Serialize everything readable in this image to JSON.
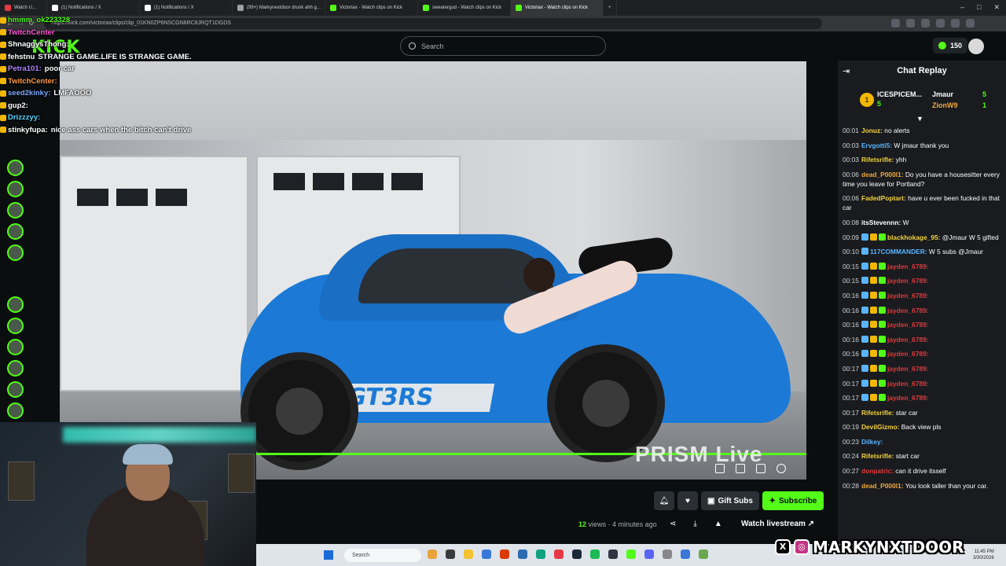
{
  "browser": {
    "tabs": [
      {
        "label": "Watch U...",
        "color": "#e63946"
      },
      {
        "label": "(1) Notifications / X",
        "color": "#ffffff"
      },
      {
        "label": "(1) Notifications / X",
        "color": "#ffffff"
      },
      {
        "label": "(99+) Markynextdoor drunk ahh g...",
        "color": "#9aa0a6"
      },
      {
        "label": "Victoriax - Watch clips on Kick",
        "color": "#53fc18"
      },
      {
        "label": "sweatergud - Watch clips on Kick",
        "color": "#53fc18"
      },
      {
        "label": "Victoriax - Watch clips on Kick",
        "color": "#53fc18"
      }
    ],
    "url": "https://kick.com/victoriax/clips/clip_01KN0ZP6NSCGN6RC8JRQT1DGDS"
  },
  "header": {
    "logo": "KICK",
    "search_placeholder": "Search",
    "points": "150"
  },
  "overlay_chat": [
    {
      "user": "hmmm_ok223328",
      "msg": "",
      "color": "#53fc18"
    },
    {
      "user": "TwitchCenter",
      "msg": "",
      "color": "#ff5ad7"
    },
    {
      "user": "ShnaggysThong:",
      "msg": "",
      "color": "#ffffff"
    },
    {
      "user": "fehstnu",
      "msg": "STRANGE GAME.LIFE IS STRANGE GAME.",
      "color": "#ffffff"
    },
    {
      "user": "Petra101:",
      "msg": "poor car",
      "color": "#b084ff"
    },
    {
      "user": "TwitchCenter:",
      "msg": "",
      "color": "#ff9a4a"
    },
    {
      "user": "seed2kinky:",
      "msg": "LMFAOOO",
      "color": "#7aa7ff"
    },
    {
      "user": "gup2:",
      "msg": "",
      "color": "#ffffff"
    },
    {
      "user": "Drizzzyy:",
      "msg": "",
      "color": "#5ad1ff"
    },
    {
      "user": "stinkyfupa:",
      "msg": "nice ass cars when the bitch can't drive",
      "color": "#ffffff"
    }
  ],
  "video": {
    "plate": "GT3RS",
    "watermark": "PRISM Live"
  },
  "actions": {
    "gift_label": "Gift Subs",
    "subscribe_label": "Subscribe",
    "views": "12",
    "views_suffix": "views",
    "ago": "4 minutes ago",
    "watch_livestream": "Watch livestream"
  },
  "chat_replay": {
    "title": "Chat Replay",
    "leaderboard": {
      "first": {
        "name": "ICESPICEM...",
        "count": "5"
      },
      "second": {
        "name": "Jmaur",
        "count": "5"
      },
      "third": {
        "name": "ZionW9",
        "count": "1"
      }
    },
    "messages": [
      {
        "time": "00:01",
        "user": "Jonuz:",
        "color": "#f2d23c",
        "text": "no alerts"
      },
      {
        "time": "00:03",
        "user": "Ervgotti5:",
        "color": "#5ab4ff",
        "text": "W jmaur thank you"
      },
      {
        "time": "00:03",
        "user": "Rifetsrifle:",
        "color": "#f2d23c",
        "text": "yhh"
      },
      {
        "time": "00:06",
        "user": "dead_P000l1:",
        "color": "#f2a93c",
        "text": "Do you have a housesitter every time you leave for Portland?"
      },
      {
        "time": "00:06",
        "user": "FadedPoptart:",
        "color": "#f2d23c",
        "text": "have u ever been fucked in that car"
      },
      {
        "time": "00:08",
        "user": "itsStevennn:",
        "color": "#ffffff",
        "text": "W"
      },
      {
        "time": "00:09",
        "user": "blackhokage_95:",
        "color": "#f2d23c",
        "text": "@Jmaur W 5 gifted"
      },
      {
        "time": "00:10",
        "user": "117COMMANDER:",
        "color": "#5ab4ff",
        "text": "W 5 subs @Jmaur"
      },
      {
        "time": "00:15",
        "user": "jayden_6789:",
        "color": "#e03a3a",
        "text": ""
      },
      {
        "time": "00:15",
        "user": "jayden_6789:",
        "color": "#e03a3a",
        "text": ""
      },
      {
        "time": "00:16",
        "user": "jayden_6789:",
        "color": "#e03a3a",
        "text": ""
      },
      {
        "time": "00:16",
        "user": "jayden_6789:",
        "color": "#e03a3a",
        "text": ""
      },
      {
        "time": "00:16",
        "user": "jayden_6789:",
        "color": "#e03a3a",
        "text": ""
      },
      {
        "time": "00:16",
        "user": "jayden_6789:",
        "color": "#e03a3a",
        "text": ""
      },
      {
        "time": "00:16",
        "user": "jayden_6789:",
        "color": "#e03a3a",
        "text": ""
      },
      {
        "time": "00:17",
        "user": "jayden_6789:",
        "color": "#e03a3a",
        "text": ""
      },
      {
        "time": "00:17",
        "user": "jayden_6789:",
        "color": "#e03a3a",
        "text": ""
      },
      {
        "time": "00:17",
        "user": "jayden_6789:",
        "color": "#e03a3a",
        "text": ""
      },
      {
        "time": "00:17",
        "user": "Rifetsrifle:",
        "color": "#f2d23c",
        "text": "star car"
      },
      {
        "time": "00:19",
        "user": "DevilGizmo:",
        "color": "#f2d23c",
        "text": "Back view pls"
      },
      {
        "time": "00:23",
        "user": "Dilkey:",
        "color": "#5ab4ff",
        "text": ""
      },
      {
        "time": "00:24",
        "user": "Rifetsrifle:",
        "color": "#f2d23c",
        "text": "start car"
      },
      {
        "time": "00:27",
        "user": "donpatric:",
        "color": "#e03a3a",
        "text": "can it drive itsself"
      },
      {
        "time": "00:28",
        "user": "dead_P000l1:",
        "color": "#f2a93c",
        "text": "You look taller than your car."
      }
    ]
  },
  "taskbar": {
    "search_label": "Search",
    "clock_time": "11:45 PM",
    "clock_date": "3/30/2026"
  },
  "brand": {
    "handle": "MARKYNXTDOOR"
  },
  "colors": {
    "kick_green": "#53fc18",
    "panel_bg": "#191b1f",
    "page_bg": "#0b0e0f"
  }
}
